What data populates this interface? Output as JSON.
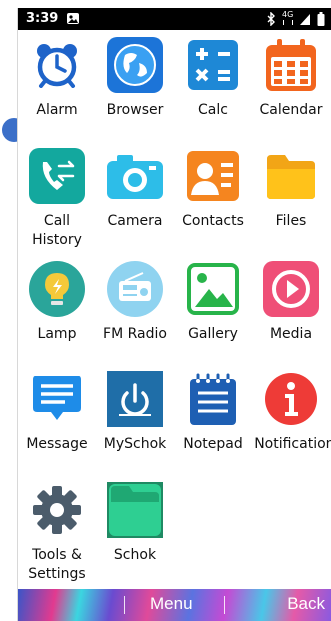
{
  "status_bar": {
    "time": "3:39",
    "icons": [
      "image-icon",
      "bluetooth-icon",
      "lte-4g-icon",
      "signal-icon",
      "battery-icon"
    ],
    "lte_label": "4G"
  },
  "apps": [
    {
      "label": "Alarm",
      "icon": "alarm-clock-icon",
      "color": "#1e63c9"
    },
    {
      "label": "Browser",
      "icon": "globe-icon",
      "color": "#1c74d8"
    },
    {
      "label": "Calc",
      "icon": "calculator-icon",
      "color": "#1e88d6"
    },
    {
      "label": "Calendar",
      "icon": "calendar-icon",
      "color": "#f2651e"
    },
    {
      "label": "Call History",
      "icon": "call-history-icon",
      "color": "#13a89e"
    },
    {
      "label": "Camera",
      "icon": "camera-icon",
      "color": "#2dbde8"
    },
    {
      "label": "Contacts",
      "icon": "contacts-icon",
      "color": "#f5851f"
    },
    {
      "label": "Files",
      "icon": "folder-icon",
      "color": "#ffc21a"
    },
    {
      "label": "Lamp",
      "icon": "lamp-icon",
      "color": "#2aa59a"
    },
    {
      "label": "FM Radio",
      "icon": "radio-icon",
      "color": "#8fd3f0"
    },
    {
      "label": "Gallery",
      "icon": "gallery-icon",
      "color": "#28b44a"
    },
    {
      "label": "Media",
      "icon": "play-icon",
      "color": "#ef4f77"
    },
    {
      "label": "Message",
      "icon": "message-icon",
      "color": "#1e8ce8"
    },
    {
      "label": "MySchok",
      "icon": "power-icon",
      "color": "#1f6ea8"
    },
    {
      "label": "Notepad",
      "icon": "notepad-icon",
      "color": "#1e5fb3"
    },
    {
      "label": "Notifications",
      "icon": "info-icon",
      "color": "#ee3b37"
    },
    {
      "label": "Tools & Settings",
      "icon": "gear-icon",
      "color": "#4b5c6b"
    },
    {
      "label": "Schok",
      "icon": "schok-folder-icon",
      "color": "#2ecf92"
    }
  ],
  "bottom_bar": {
    "menu": "Menu",
    "back": "Back"
  }
}
